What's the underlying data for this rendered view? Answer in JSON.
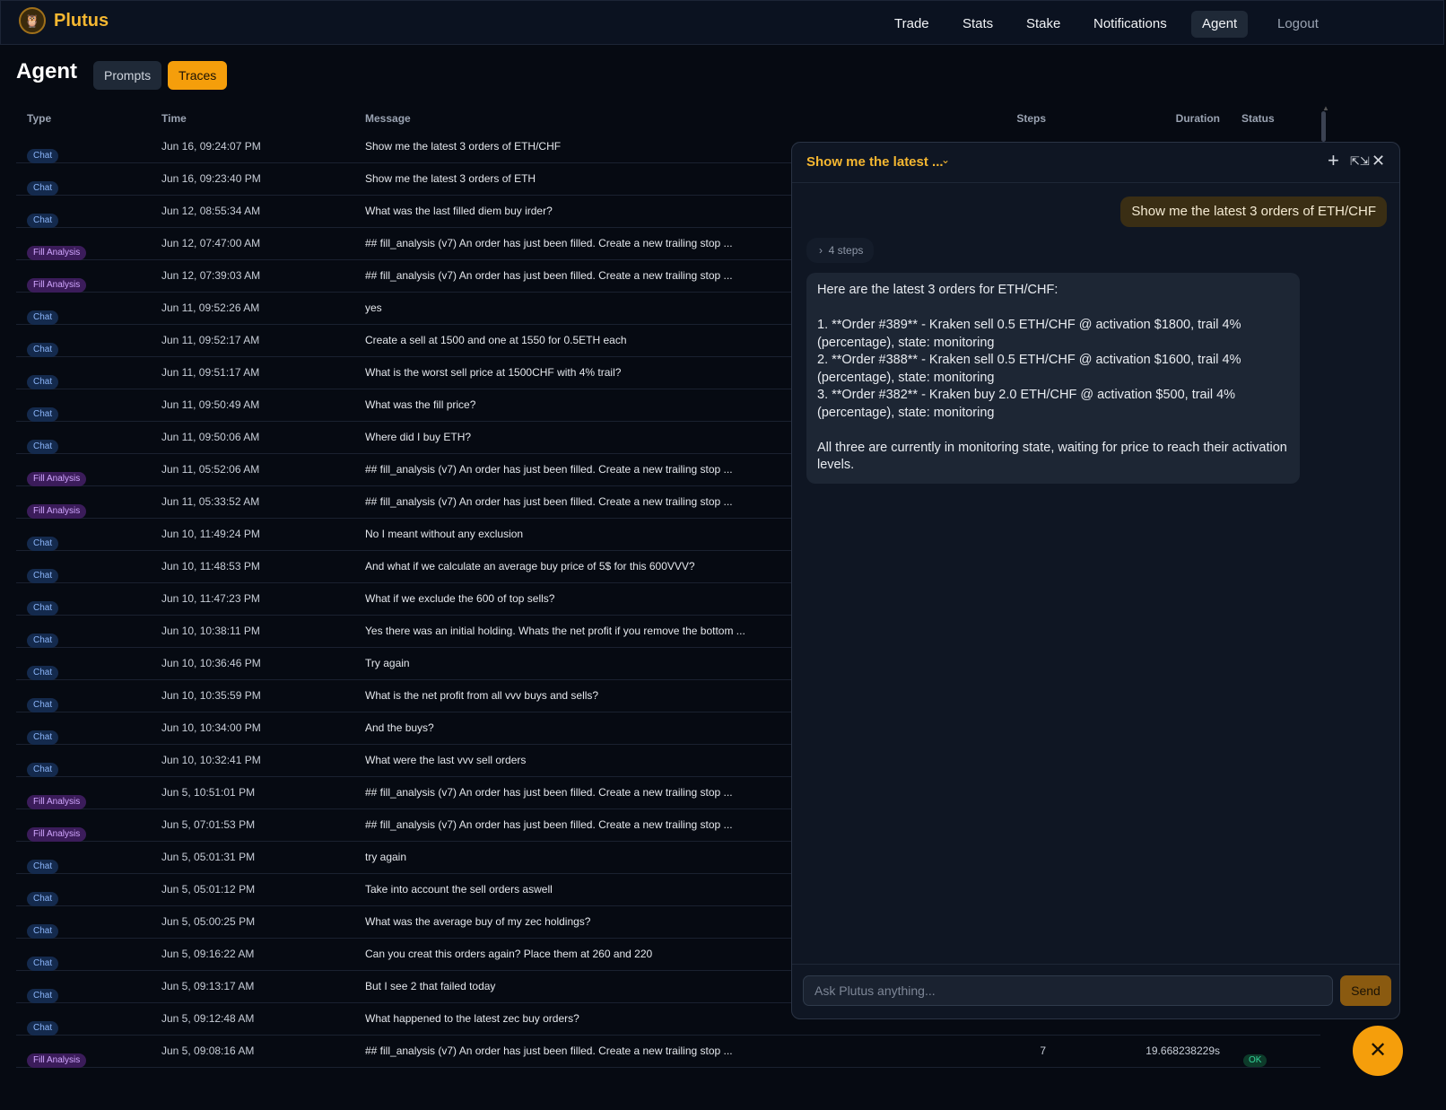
{
  "nav": {
    "brand": "Plutus",
    "items": [
      {
        "label": "Trade"
      },
      {
        "label": "Stats"
      },
      {
        "label": "Stake"
      },
      {
        "label": "Notifications"
      },
      {
        "label": "Agent"
      },
      {
        "label": "Logout"
      }
    ]
  },
  "page": {
    "title": "Agent",
    "tabs": [
      "Prompts",
      "Traces"
    ]
  },
  "table": {
    "headers": {
      "type": "Type",
      "time": "Time",
      "message": "Message",
      "steps": "Steps",
      "duration": "Duration",
      "status": "Status"
    },
    "rows": [
      {
        "type": "Chat",
        "time": "Jun 16, 09:24:07 PM",
        "message": "Show me the latest 3 orders of ETH/CHF"
      },
      {
        "type": "Chat",
        "time": "Jun 16, 09:23:40 PM",
        "message": "Show me the latest 3 orders of ETH"
      },
      {
        "type": "Chat",
        "time": "Jun 12, 08:55:34 AM",
        "message": "What was the last filled diem buy irder?"
      },
      {
        "type": "Fill Analysis",
        "time": "Jun 12, 07:47:00 AM",
        "message": "## fill_analysis (v7) An order has just been filled. Create a new trailing stop ..."
      },
      {
        "type": "Fill Analysis",
        "time": "Jun 12, 07:39:03 AM",
        "message": "## fill_analysis (v7) An order has just been filled. Create a new trailing stop ..."
      },
      {
        "type": "Chat",
        "time": "Jun 11, 09:52:26 AM",
        "message": "yes"
      },
      {
        "type": "Chat",
        "time": "Jun 11, 09:52:17 AM",
        "message": "Create a sell at 1500 and one at 1550 for 0.5ETH each"
      },
      {
        "type": "Chat",
        "time": "Jun 11, 09:51:17 AM",
        "message": "What is the worst sell price at 1500CHF with 4% trail?"
      },
      {
        "type": "Chat",
        "time": "Jun 11, 09:50:49 AM",
        "message": "What was the fill price?"
      },
      {
        "type": "Chat",
        "time": "Jun 11, 09:50:06 AM",
        "message": "Where did I buy ETH?"
      },
      {
        "type": "Fill Analysis",
        "time": "Jun 11, 05:52:06 AM",
        "message": "## fill_analysis (v7) An order has just been filled. Create a new trailing stop ..."
      },
      {
        "type": "Fill Analysis",
        "time": "Jun 11, 05:33:52 AM",
        "message": "## fill_analysis (v7) An order has just been filled. Create a new trailing stop ..."
      },
      {
        "type": "Chat",
        "time": "Jun 10, 11:49:24 PM",
        "message": "No I meant without any exclusion"
      },
      {
        "type": "Chat",
        "time": "Jun 10, 11:48:53 PM",
        "message": "And what if we calculate an average buy price of 5$ for this 600VVV?"
      },
      {
        "type": "Chat",
        "time": "Jun 10, 11:47:23 PM",
        "message": "What if we exclude the 600 of top sells?"
      },
      {
        "type": "Chat",
        "time": "Jun 10, 10:38:11 PM",
        "message": "Yes there was an initial holding. Whats the net profit if you remove the bottom ..."
      },
      {
        "type": "Chat",
        "time": "Jun 10, 10:36:46 PM",
        "message": "Try again"
      },
      {
        "type": "Chat",
        "time": "Jun 10, 10:35:59 PM",
        "message": "What is the net profit from all vvv buys and sells?"
      },
      {
        "type": "Chat",
        "time": "Jun 10, 10:34:00 PM",
        "message": "And the buys?"
      },
      {
        "type": "Chat",
        "time": "Jun 10, 10:32:41 PM",
        "message": "What were the last vvv sell orders"
      },
      {
        "type": "Fill Analysis",
        "time": "Jun 5, 10:51:01 PM",
        "message": "## fill_analysis (v7) An order has just been filled. Create a new trailing stop ..."
      },
      {
        "type": "Fill Analysis",
        "time": "Jun 5, 07:01:53 PM",
        "message": "## fill_analysis (v7) An order has just been filled. Create a new trailing stop ..."
      },
      {
        "type": "Chat",
        "time": "Jun 5, 05:01:31 PM",
        "message": "try again"
      },
      {
        "type": "Chat",
        "time": "Jun 5, 05:01:12 PM",
        "message": "Take into account the sell orders aswell"
      },
      {
        "type": "Chat",
        "time": "Jun 5, 05:00:25 PM",
        "message": "What was the average buy of my zec holdings?"
      },
      {
        "type": "Chat",
        "time": "Jun 5, 09:16:22 AM",
        "message": "Can you creat this orders again? Place them at 260 and 220"
      },
      {
        "type": "Chat",
        "time": "Jun 5, 09:13:17 AM",
        "message": "But I see 2 that failed today"
      },
      {
        "type": "Chat",
        "time": "Jun 5, 09:12:48 AM",
        "message": "What happened to the latest zec buy orders?"
      },
      {
        "type": "Fill Analysis",
        "time": "Jun 5, 09:08:16 AM",
        "message": "## fill_analysis (v7) An order has just been filled. Create a new trailing stop ...",
        "steps": "7",
        "duration": "19.668238229s",
        "status": "OK"
      }
    ]
  },
  "chat": {
    "title": "Show me the latest ...",
    "user_message": "Show me the latest 3 orders of ETH/CHF",
    "steps_label": "4 steps",
    "assistant_lines": [
      "Here are the latest 3 orders for ETH/CHF:",
      "",
      "1. **Order #389** - Kraken sell 0.5 ETH/CHF @ activation $1800, trail 4% (percentage), state: monitoring",
      "2. **Order #388** - Kraken sell 0.5 ETH/CHF @ activation $1600, trail 4% (percentage), state: monitoring",
      "3. **Order #382** - Kraken buy 2.0 ETH/CHF @ activation $500, trail 4% (percentage), state: monitoring",
      "",
      "All three are currently in monitoring state, waiting for price to reach their activation levels."
    ],
    "input_placeholder": "Ask Plutus anything...",
    "send_label": "Send"
  },
  "icons": {
    "logo": "owl-icon",
    "chevron": "chevron-down-icon",
    "new": "plus-icon",
    "expand": "expand-icon",
    "close": "close-icon",
    "steps_chevron": "chevron-right-icon",
    "fab": "close-icon"
  },
  "colors": {
    "accent": "#f59e0b",
    "background": "#060a12",
    "panel": "#0f1623",
    "ok": "#34d399"
  }
}
